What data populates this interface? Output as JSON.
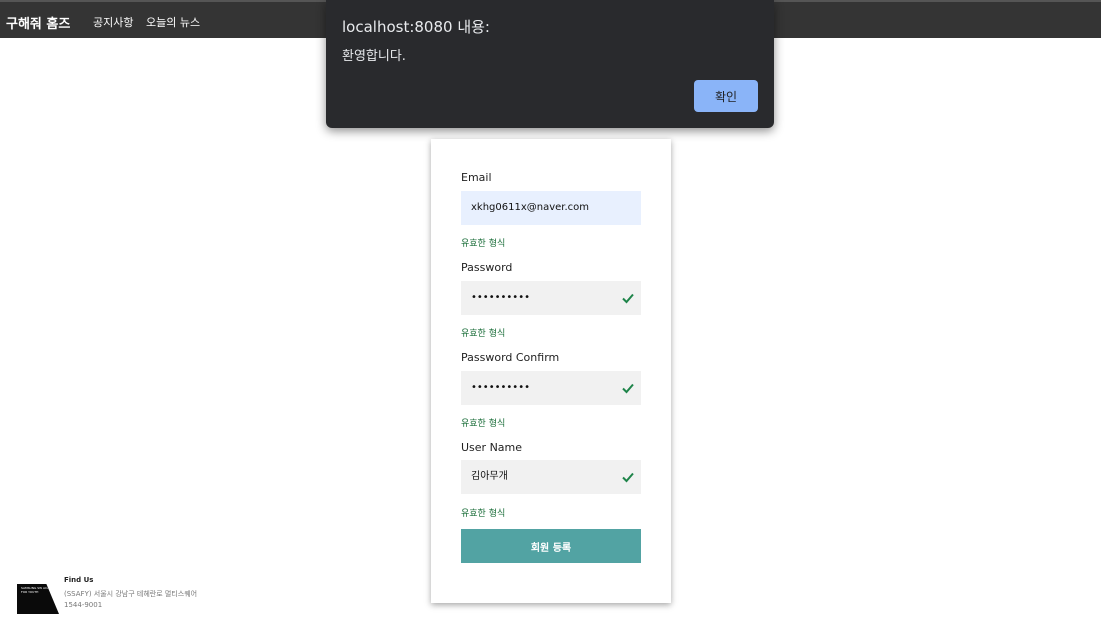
{
  "navbar": {
    "brand": "구해줘 홈즈",
    "links": [
      "공지사항",
      "오늘의 뉴스"
    ]
  },
  "dialog": {
    "title": "localhost:8080 내용:",
    "message": "환영합니다.",
    "ok_label": "확인"
  },
  "form": {
    "email": {
      "label": "Email",
      "value": "xkhg0611x@naver.com",
      "status": "유효한 형식"
    },
    "password": {
      "label": "Password",
      "value": "••••••••••",
      "status": "유효한 형식"
    },
    "password_confirm": {
      "label": "Password Confirm",
      "value": "••••••••••",
      "status": "유효한 형식"
    },
    "username": {
      "label": "User Name",
      "value": "김아무개",
      "status": "유효한 형식"
    },
    "submit_label": "회원 등록"
  },
  "footer": {
    "title": "Find Us",
    "address": "(SSAFY) 서울시 강남구 테헤란로 멀티스퀘어",
    "phone": "1544-9001",
    "logo_text": "SAMSUNG SW ACADEMY FOR YOUTH"
  },
  "colors": {
    "navbar_bg": "#343434",
    "dialog_bg": "#292a2d",
    "dialog_button": "#8ab4f8",
    "submit_button": "#52a3a3",
    "valid_text": "#1b6e3a",
    "check_icon": "#1e8449"
  }
}
